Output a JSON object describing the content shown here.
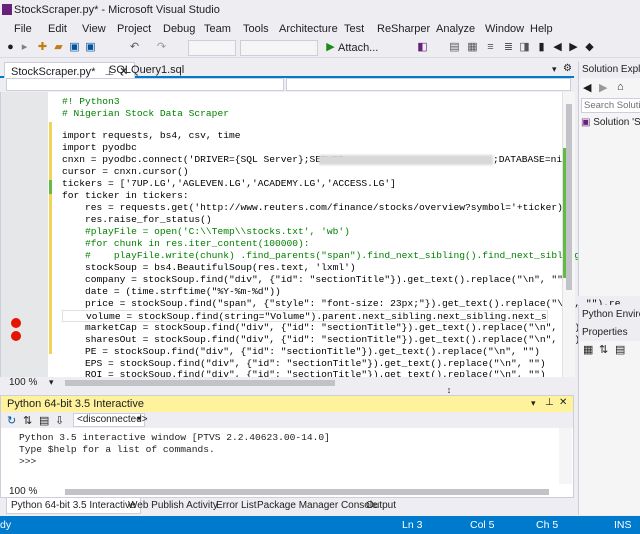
{
  "window": {
    "title": "StockScraper.py* - Microsoft Visual Studio"
  },
  "menu": [
    "File",
    "Edit",
    "View",
    "Project",
    "Debug",
    "Team",
    "Tools",
    "Architecture",
    "Test",
    "ReSharper",
    "Analyze",
    "Window",
    "Help"
  ],
  "toolbar": {
    "attach_label": "Attach...",
    "play_icon": "play-icon"
  },
  "tabs": [
    {
      "label": "StockScraper.py*"
    },
    {
      "label": "SQLQuery1.sql"
    }
  ],
  "editor": {
    "zoom": "100 %",
    "lines": [
      "#! Python3",
      "# Nigerian Stock Data Scraper",
      "",
      "import requests, bs4, csv, time",
      "import pyodbc",
      "cnxn = pyodbc.connect('DRIVER={SQL Server};SERVER=",
      "cursor = cnxn.cursor()",
      "tickers = ['7UP.LG','AGLEVEN.LG','ACADEMY.LG','ACCESS.LG']",
      "for ticker in tickers:",
      "    res = requests.get('http://www.reuters.com/finance/stocks/overview?symbol='+ticker)",
      "    res.raise_for_status()",
      "    #playFile = open('C:\\\\Temp\\\\stocks.txt', 'wb')",
      "    #for chunk in res.iter_content(100000):",
      "    #    playFile.write(chunk) .find_parents(\"span\").find_next_sibling().find_next_sibling().get_",
      "    stockSoup = bs4.BeautifulSoup(res.text, 'lxml')",
      "    company = stockSoup.find(\"div\", {\"id\": \"sectionTitle\"}).get_text().replace(\"\\n\", \"\")",
      "    date = (time.strftime(\"%Y-%m-%d\"))",
      "    price = stockSoup.find(\"span\", {\"style\": \"font-size: 23px;\"}).get_text().replace(\"\\n\", \"\").re",
      "    volume = stockSoup.find(string=\"Volume\").parent.next_sibling.next_sibling.next_s",
      "    marketCap = stockSoup.find(\"div\", {\"id\": \"sectionTitle\"}).get_text().replace(\"\\n\", \"\")",
      "    sharesOut = stockSoup.find(\"div\", {\"id\": \"sectionTitle\"}).get_text().replace(\"\\n\", \"\")",
      "    PE = stockSoup.find(\"div\", {\"id\": \"sectionTitle\"}).get_text().replace(\"\\n\", \"\")",
      "    EPS = stockSoup.find(\"div\", {\"id\": \"sectionTitle\"}).get_text().replace(\"\\n\", \"\")",
      "    ROI = stockSoup.find(\"div\", {\"id\": \"sectionTitle\"}).get_text().replace(\"\\n\", \"\")"
    ],
    "line5_suffix": ";DATABASE=nig"
  },
  "interactive": {
    "title": "Python 64-bit 3.5 Interactive",
    "scope": "<disconnected>",
    "zoom": "100 %",
    "output": [
      "Python 3.5 interactive window [PTVS 2.2.40623.00-14.0]",
      "Type $help for a list of commands.",
      ">>>"
    ]
  },
  "bottom_tabs": [
    "Python 64-bit 3.5 Interactive",
    "Web Publish Activity",
    "Error List",
    "Package Manager Console",
    "Output"
  ],
  "status": {
    "left": "dy",
    "ln": "Ln 3",
    "col": "Col 5",
    "ch": "Ch 5",
    "ins": "INS"
  },
  "solution": {
    "title": "Solution Explor",
    "search_placeholder": "Search Solution",
    "item": "Solution 'Sto"
  },
  "pyenv": {
    "title": "Python Environ"
  },
  "properties": {
    "title": "Properties"
  },
  "colors": {
    "accent": "#007ACC",
    "interactive_header": "#FFF29D",
    "breakpoint": "#E51400"
  }
}
